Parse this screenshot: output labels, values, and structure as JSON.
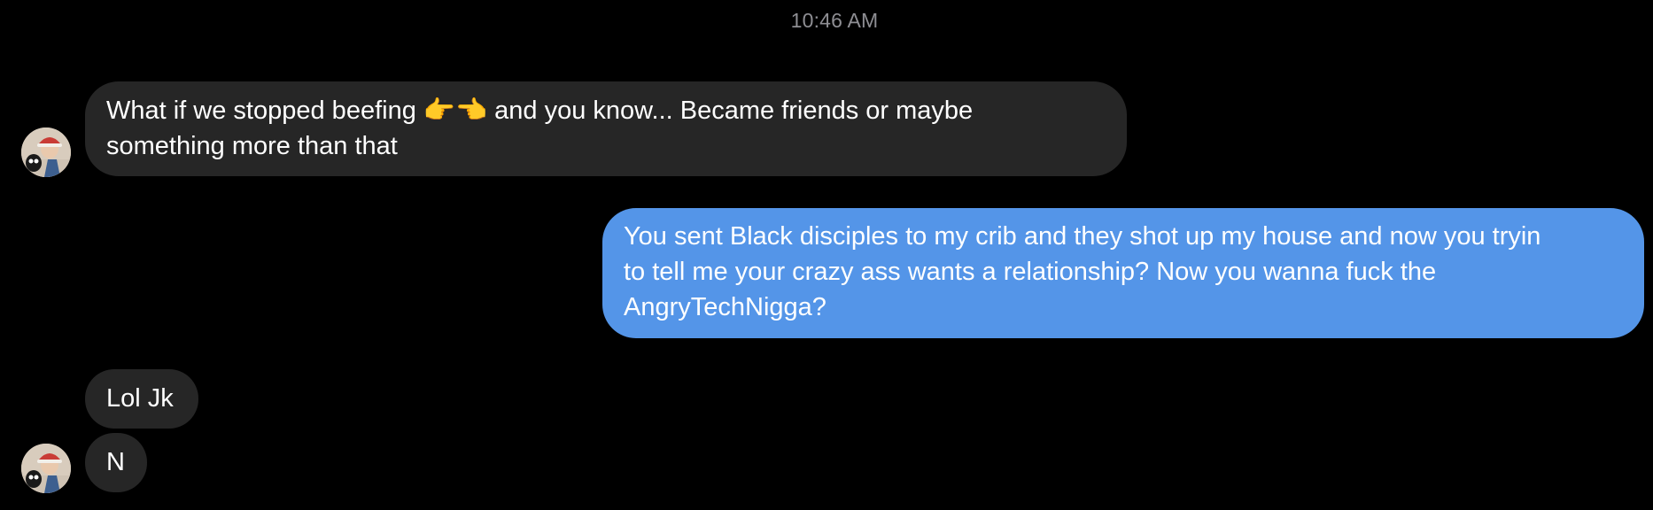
{
  "conversation": {
    "timestamp": "10:46 AM",
    "messages": [
      {
        "direction": "incoming",
        "text": "What if we stopped beefing 👉👈 and you know... Became friends or maybe\nsomething more than that"
      },
      {
        "direction": "outgoing",
        "text": "You sent Black disciples to my crib and they shot up my house and now you tryin\nto tell me your crazy ass wants a relationship? Now you wanna fuck the\nAngryTechNigga?"
      },
      {
        "direction": "incoming",
        "text": "Lol Jk"
      },
      {
        "direction": "incoming",
        "text": "N"
      }
    ]
  },
  "colors": {
    "background": "#000000",
    "incoming_bubble": "#262626",
    "outgoing_bubble": "#5495e8",
    "timestamp_text": "#8e8e93",
    "message_text": "#ffffff"
  },
  "icons": {
    "sender_avatar": "avatar"
  }
}
